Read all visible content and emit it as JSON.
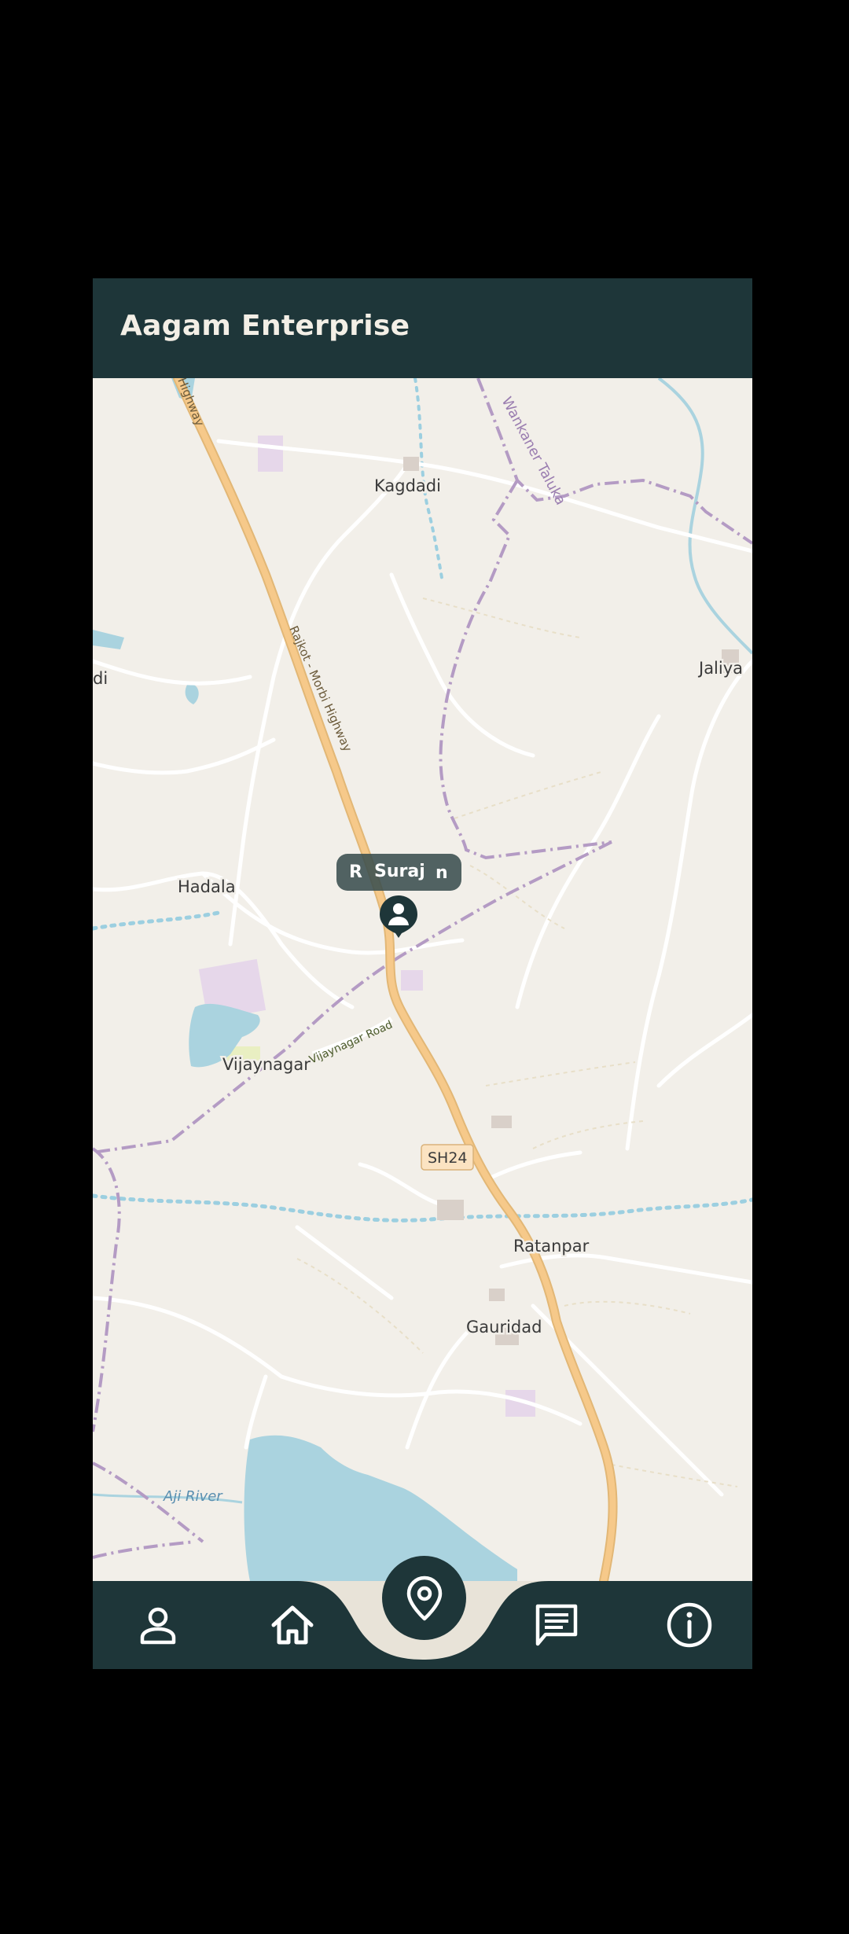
{
  "app": {
    "title": "Aagam Enterprise"
  },
  "map": {
    "labels": {
      "kagdadi": "Kagdadi",
      "wankaner_taluka": "Wankaner Taluka",
      "jaliya": "Jaliya",
      "di": "di",
      "highway_top": "Highway",
      "rajkot_morbi_highway": "Rajkot - Morbi Highway",
      "hadala": "Hadala",
      "vijaynagar": "Vijaynagar",
      "vijaynagar_road": "Vijaynagar Road",
      "sh24": "SH24",
      "ratanpar": "Ratanpar",
      "gauridad": "Gauridad",
      "aji_river": "Aji River"
    },
    "marker": {
      "chip_left": "R",
      "name": "Suraj",
      "chip_right": "n"
    }
  },
  "nav": {
    "items": [
      {
        "id": "profile",
        "icon": "person-icon"
      },
      {
        "id": "home",
        "icon": "home-icon"
      },
      {
        "id": "location",
        "icon": "location-pin-icon",
        "active": true
      },
      {
        "id": "messages",
        "icon": "message-icon"
      },
      {
        "id": "info",
        "icon": "info-icon"
      }
    ]
  },
  "colors": {
    "appbar": "#1e3639",
    "title_text": "#f3efe6",
    "map_background": "#f2efe9",
    "highway": "#f6c98a",
    "water": "#aad3df",
    "boundary": "#b49bc4",
    "nav_curve": "#e8e3d8"
  }
}
